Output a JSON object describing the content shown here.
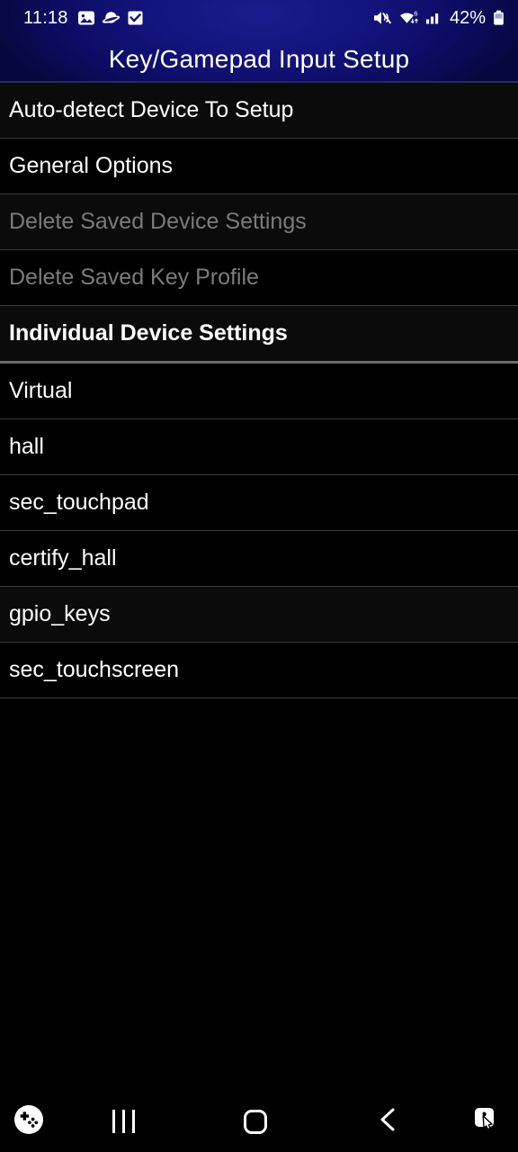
{
  "status_bar": {
    "clock": "11:18",
    "left_icons": [
      {
        "name": "gallery-icon",
        "label": "Gallery"
      },
      {
        "name": "samsung-internet-icon",
        "label": "Samsung Internet"
      },
      {
        "name": "checkbox-notification-icon",
        "label": "Task"
      }
    ],
    "right_icons": [
      {
        "name": "mute-icon",
        "label": "Sound muted"
      },
      {
        "name": "wifi-icon",
        "label": "Wi-Fi 6",
        "badge": "6"
      },
      {
        "name": "cellular-signal-icon",
        "label": "Signal"
      }
    ],
    "battery_percent": "42%",
    "battery_icon": "battery-icon"
  },
  "header": {
    "title": "Key/Gamepad Input Setup",
    "accent_color": "#13137b",
    "title_color": "#ffffff"
  },
  "list": {
    "items": [
      {
        "label": "Auto-detect Device To Setup",
        "state": "enabled",
        "style": "normal",
        "tinted": true,
        "interactable": true
      },
      {
        "label": "General Options",
        "state": "enabled",
        "style": "normal",
        "tinted": false,
        "interactable": true
      },
      {
        "label": "Delete Saved Device Settings",
        "state": "disabled",
        "style": "normal",
        "tinted": true,
        "interactable": false
      },
      {
        "label": "Delete Saved Key Profile",
        "state": "disabled",
        "style": "normal",
        "tinted": false,
        "interactable": false
      },
      {
        "label": "Individual Device Settings",
        "state": "enabled",
        "style": "section",
        "tinted": true,
        "interactable": false
      },
      {
        "label": "Virtual",
        "state": "enabled",
        "style": "normal",
        "tinted": false,
        "interactable": true
      },
      {
        "label": "hall",
        "state": "enabled",
        "style": "normal",
        "tinted": false,
        "interactable": true
      },
      {
        "label": "sec_touchpad",
        "state": "enabled",
        "style": "normal",
        "tinted": false,
        "interactable": true
      },
      {
        "label": "certify_hall",
        "state": "enabled",
        "style": "normal",
        "tinted": false,
        "interactable": true
      },
      {
        "label": "gpio_keys",
        "state": "enabled",
        "style": "normal",
        "tinted": true,
        "interactable": true
      },
      {
        "label": "sec_touchscreen",
        "state": "enabled",
        "style": "normal",
        "tinted": false,
        "interactable": true
      }
    ],
    "separator_color": "#3c3c3c",
    "section_separator_color": "#6a6a6a",
    "disabled_text_color": "#7b7b7b",
    "text_color": "#ffffff"
  },
  "navigation_bar": {
    "buttons": [
      {
        "name": "gamepad-overlay-icon",
        "label": "Gamepad overlay"
      },
      {
        "name": "recents-icon",
        "label": "Recents"
      },
      {
        "name": "home-icon",
        "label": "Home"
      },
      {
        "name": "back-icon",
        "label": "Back"
      },
      {
        "name": "show-touches-icon",
        "label": "Touch pointer"
      }
    ],
    "background": "#000000"
  }
}
